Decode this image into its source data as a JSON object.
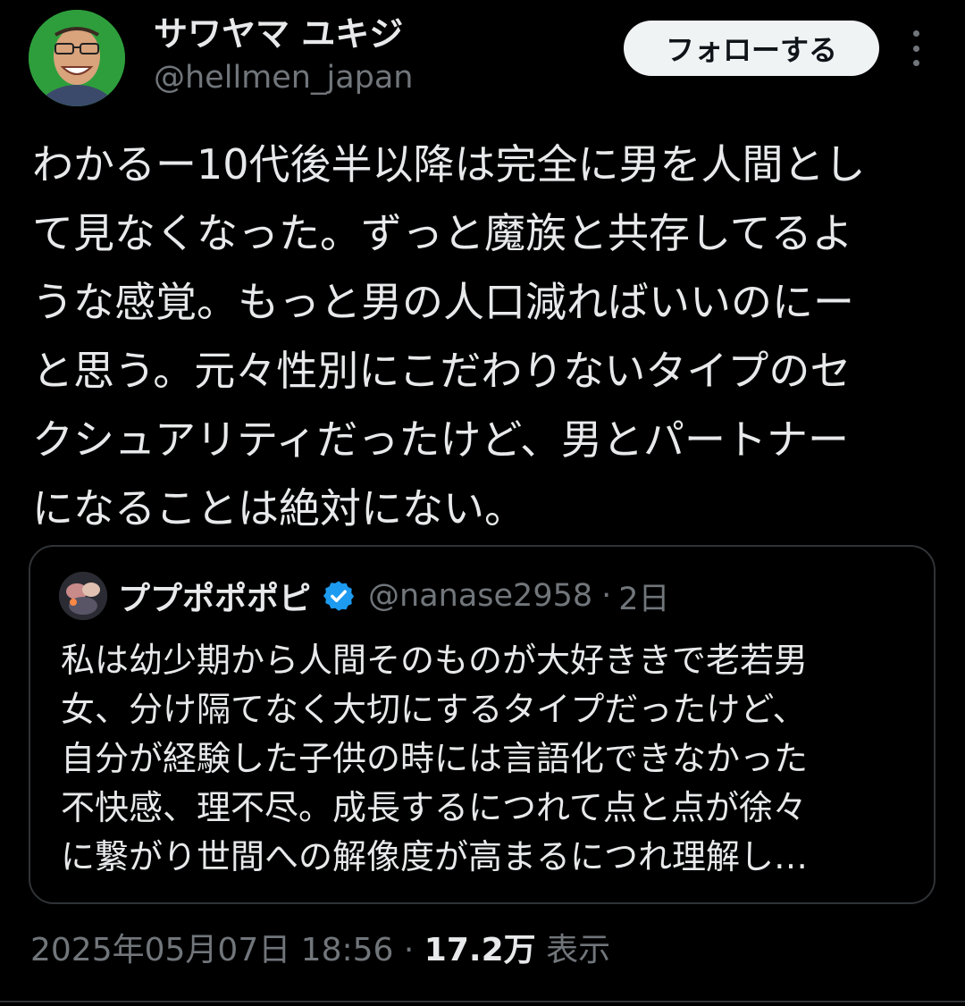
{
  "author": {
    "display_name": "サワヤマ ユキジ",
    "handle": "@hellmen_japan"
  },
  "follow_label": "フォローする",
  "tweet": {
    "lines": [
      "わかるー10代後半以降は完全に男を人間とし",
      "て見なくなった。ずっと魔族と共存してるよ",
      "うな感覚。もっと男の人口減ればいいのにー",
      "と思う。元々性別にこだわりないタイプのセ",
      "クシュアリティだったけど、男とパートナー",
      "になることは絶対にない。"
    ]
  },
  "quote": {
    "display_name": "ププポポポピ",
    "handle": "@nanase2958",
    "separator": "·",
    "time": "2日",
    "verified_color": "#1d9bf0",
    "lines": [
      "私は幼少期から人間そのものが大好ききで老若男",
      "女、分け隔てなく大切にするタイプだったけど、",
      "自分が経験した子供の時には言語化できなかった",
      "不快感、理不尽。成長するにつれて点と点が徐々",
      "に繋がり世間への解像度が高まるにつれ理解し…"
    ]
  },
  "meta": {
    "timestamp": "2025年05月07日 18:56",
    "separator": "·",
    "views_count": "17.2万",
    "views_label": "表示"
  },
  "icons": {
    "more": "more-vertical-icon",
    "verified": "verified-badge-icon"
  }
}
